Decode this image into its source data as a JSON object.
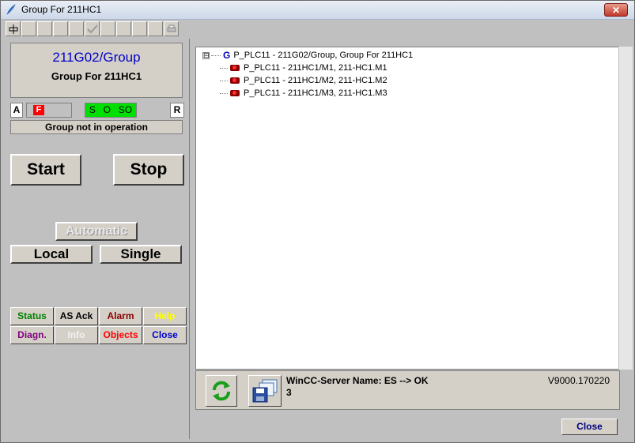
{
  "window": {
    "title": "Group For 211HC1",
    "close_glyph": "✕"
  },
  "faceplate": {
    "tag": "211G02/Group",
    "description": "Group For 211HC1",
    "indicators": {
      "a": "A",
      "f": "F",
      "s": "S",
      "o": "O",
      "so": "SO",
      "r": "R"
    },
    "operation_status": "Group not in operation",
    "buttons": {
      "start": "Start",
      "stop": "Stop",
      "automatic": "Automatic",
      "local": "Local",
      "single": "Single"
    },
    "nav": [
      {
        "label": "Status",
        "color": "#008000"
      },
      {
        "label": "AS Ack",
        "color": "#000000"
      },
      {
        "label": "Alarm",
        "color": "#8b0000"
      },
      {
        "label": "Help",
        "color": "#ffff00"
      },
      {
        "label": "Diagn.",
        "color": "#800080"
      },
      {
        "label": "Info",
        "color": "#f0f0f0"
      },
      {
        "label": "Objects",
        "color": "#ff0000"
      },
      {
        "label": "Close",
        "color": "#0000cc"
      }
    ]
  },
  "tree": {
    "root": {
      "expander": "⊟",
      "icon": "G",
      "label": "P_PLC11 - 211G02/Group,  Group For 211HC1"
    },
    "children": [
      {
        "label": "P_PLC11 - 211HC1/M1,  211-HC1.M1"
      },
      {
        "label": "P_PLC11 - 211HC1/M2,  211-HC1.M2"
      },
      {
        "label": "P_PLC11 - 211HC1/M3,  211-HC1.M3"
      }
    ]
  },
  "info": {
    "server_line1": "WinCC-Server Name: ES  --> OK",
    "server_line2": "3",
    "version": "V9000.170220"
  },
  "footer": {
    "close_label": "Close"
  }
}
